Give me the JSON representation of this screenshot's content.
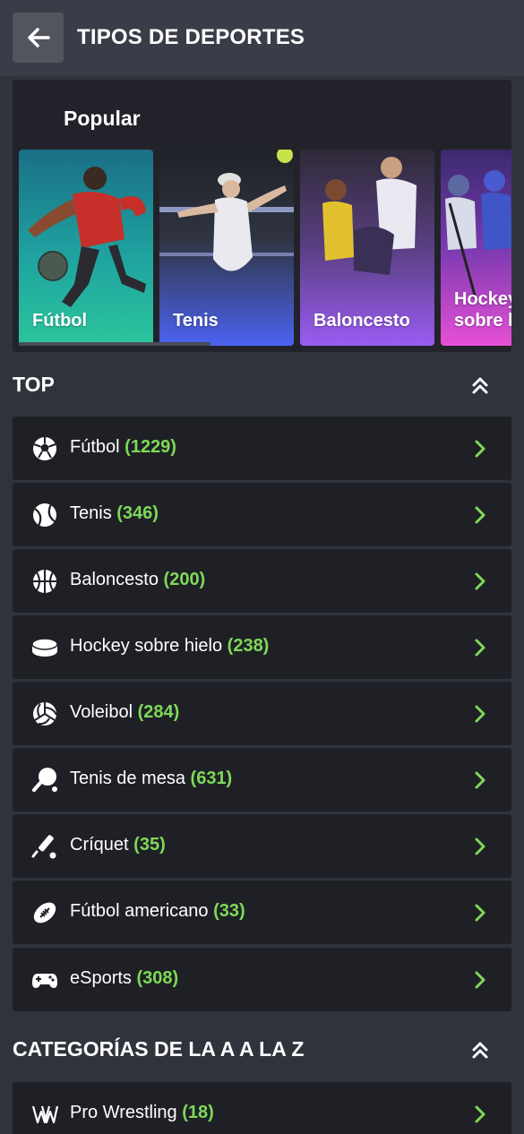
{
  "header": {
    "title": "TIPOS DE DEPORTES"
  },
  "popular": {
    "title": "Popular",
    "cards": [
      {
        "label": "Fútbol",
        "color_top": "#1f8a8f",
        "color_bottom": "#2cc0a0"
      },
      {
        "label": "Tenis",
        "color_top": "#2a2d35",
        "color_bottom": "#4a5ff0"
      },
      {
        "label": "Baloncesto",
        "color_top": "#3a2f4a",
        "color_bottom": "#8e5cf0"
      },
      {
        "label": "Hockey sobre hielo",
        "label_visible": "Hockey\nsobre h",
        "color_top": "#3a2c6a",
        "color_bottom": "#e04fd8"
      }
    ]
  },
  "top": {
    "title": "TOP",
    "items": [
      {
        "name": "Fútbol",
        "count": "(1229)",
        "icon": "soccer-ball-icon"
      },
      {
        "name": "Tenis",
        "count": "(346)",
        "icon": "tennis-ball-icon"
      },
      {
        "name": "Baloncesto",
        "count": "(200)",
        "icon": "basketball-icon"
      },
      {
        "name": "Hockey sobre hielo",
        "count": "(238)",
        "icon": "hockey-puck-icon"
      },
      {
        "name": "Voleibol",
        "count": "(284)",
        "icon": "volleyball-icon"
      },
      {
        "name": "Tenis de mesa",
        "count": "(631)",
        "icon": "ping-pong-icon"
      },
      {
        "name": "Críquet",
        "count": "(35)",
        "icon": "cricket-bat-icon"
      },
      {
        "name": "Fútbol americano",
        "count": "(33)",
        "icon": "american-football-icon"
      },
      {
        "name": "eSports",
        "count": "(308)",
        "icon": "gamepad-icon"
      }
    ]
  },
  "az": {
    "title": "CATEGORÍAS DE LA A A LA Z",
    "items": [
      {
        "name": "Pro Wrestling",
        "count": "(18)",
        "icon": "wwe-logo-icon"
      }
    ]
  },
  "colors": {
    "accent_green": "#7ed957",
    "row_bg": "#1f2026",
    "page_bg": "#30333c"
  }
}
